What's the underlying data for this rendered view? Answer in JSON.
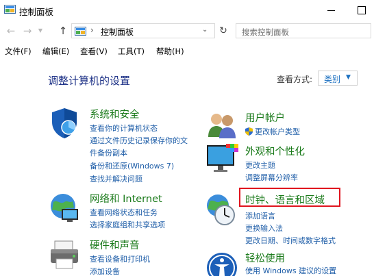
{
  "window": {
    "title": "控制面板"
  },
  "address": {
    "path": "控制面板",
    "separator": "›",
    "search_placeholder": "搜索控制面板"
  },
  "menu": {
    "items": [
      "文件(F)",
      "编辑(E)",
      "查看(V)",
      "工具(T)",
      "帮助(H)"
    ]
  },
  "content": {
    "title": "调整计算机的设置",
    "view_label": "查看方式:",
    "view_value": "类别"
  },
  "categories": {
    "system": {
      "title": "系统和安全",
      "links": [
        "查看你的计算机状态",
        "通过文件历史记录保存你的文",
        "件备份副本",
        "备份和还原(Windows 7)",
        "查找并解决问题"
      ]
    },
    "network": {
      "title": "网络和 Internet",
      "links": [
        "查看网络状态和任务",
        "选择家庭组和共享选项"
      ]
    },
    "hardware": {
      "title": "硬件和声音",
      "links": [
        "查看设备和打印机",
        "添加设备"
      ]
    },
    "users": {
      "title": "用户帐户",
      "links": [
        "更改帐户类型"
      ]
    },
    "appearance": {
      "title": "外观和个性化",
      "links": [
        "更改主题",
        "调整屏幕分辨率"
      ]
    },
    "clock": {
      "title": "时钟、语言和区域",
      "links": [
        "添加语言",
        "更换输入法",
        "更改日期、时间或数字格式"
      ]
    },
    "ease": {
      "title": "轻松使用",
      "links": [
        "使用 Windows 建议的设置"
      ]
    }
  },
  "colors": {
    "link": "#1f5ea8",
    "category_title": "#1a7a1a",
    "page_title": "#1e3287",
    "highlight": "#e0141e"
  }
}
